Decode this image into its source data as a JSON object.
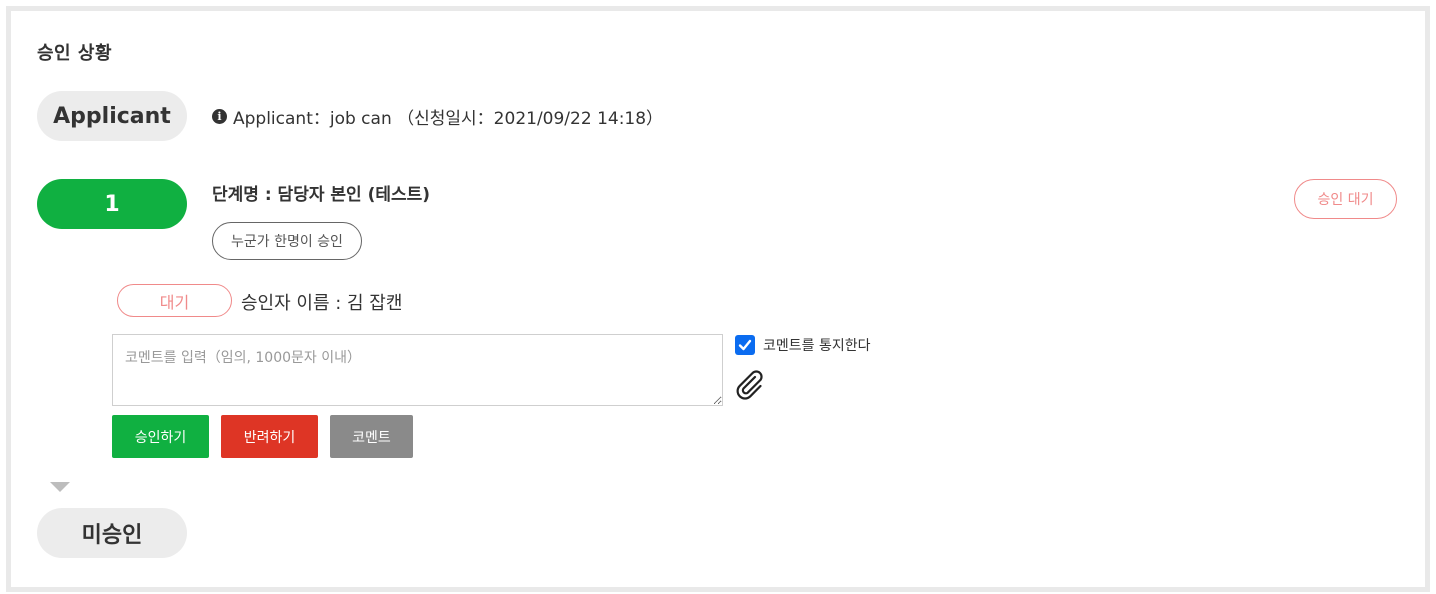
{
  "section": {
    "title": "승인 상황"
  },
  "applicant": {
    "pill_label": "Applicant",
    "info_icon": "info-circle-icon",
    "info_text": "Applicant：job can （신청일시：2021/09/22 14:18）"
  },
  "step": {
    "number": "1",
    "name": "단계명 : 담당자 본인 (테스트)",
    "rule": "누군가 한명이 승인",
    "status": "승인 대기",
    "approver": {
      "status": "대기",
      "name": "승인자 이름 : 김 잡캔"
    },
    "comment": {
      "placeholder": "코멘트를 입력（임의, 1000문자 이내）",
      "value": "",
      "notify_label": "코멘트를 통지한다",
      "notify_checked": true,
      "attach_icon": "paperclip-icon"
    },
    "buttons": {
      "approve": "승인하기",
      "reject": "반려하기",
      "comment": "코멘트"
    }
  },
  "next": {
    "pill_label": "미승인"
  },
  "colors": {
    "green": "#10b041",
    "red": "#de3525",
    "gray": "#8a8a8a",
    "pending_pink": "#f08a8a",
    "checkbox_blue": "#0b6cf0"
  }
}
